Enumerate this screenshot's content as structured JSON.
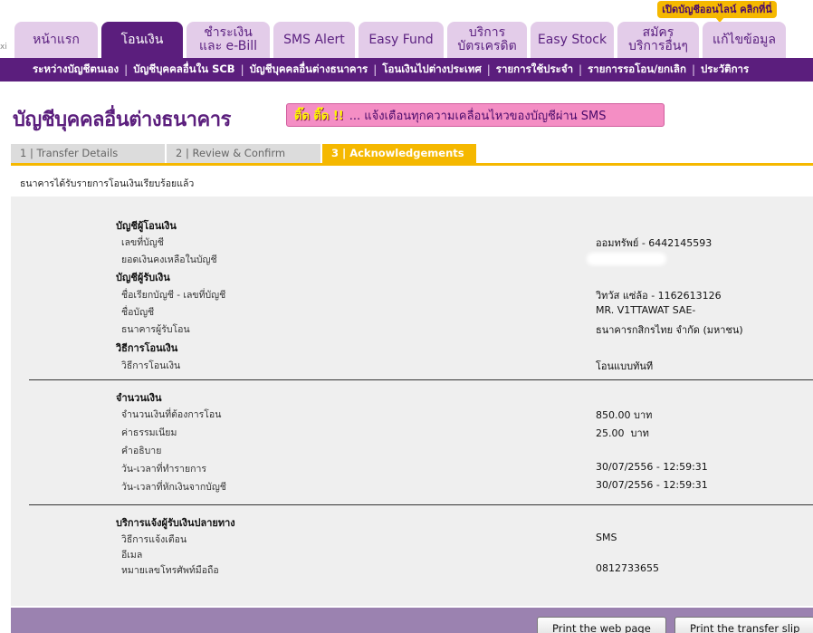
{
  "promo": {
    "label": "เปิดบัญชีออนไลน์ คลิกที่นี่"
  },
  "corner_mark": "xi",
  "tabs": [
    {
      "label": "หน้าแรก"
    },
    {
      "label": "โอนเงิน"
    },
    {
      "label": "ชำระเงิน\nและ e-Bill"
    },
    {
      "label": "SMS Alert"
    },
    {
      "label": "Easy Fund"
    },
    {
      "label": "บริการ\nบัตรเครดิต"
    },
    {
      "label": "Easy Stock"
    },
    {
      "label": "สมัคร\nบริการอื่นๆ"
    },
    {
      "label": "แก้ไขข้อมูล"
    }
  ],
  "subnav": [
    "ระหว่างบัญชีตนเอง",
    "บัญชีบุคคลอื่นใน SCB",
    "บัญชีบุคคลอื่นต่างธนาคาร",
    "โอนเงินไปต่างประเทศ",
    "รายการใช้ประจำ",
    "รายการรอโอน/ยกเลิก",
    "ประวัติการ"
  ],
  "page_title": "บัญชีบุคคลอื่นต่างธนาคาร",
  "banner": {
    "highlight": "ติ๊ด ติ๊ด !!",
    "text": "... แจ้งเตือนทุกความเคลื่อนไหวของบัญชีผ่าน SMS"
  },
  "steps": [
    {
      "label": "1 | Transfer Details"
    },
    {
      "label": "2 | Review & Confirm"
    },
    {
      "label": "3 | Acknowledgements"
    }
  ],
  "confirm_message": "ธนาคารได้รับรายการโอนเงินเรียบร้อยแล้ว",
  "from_account": {
    "heading": "บัญชีผู้โอนเงิน",
    "account_number_label": "เลขที่บัญชี",
    "account_number_value": "ออมทรัพย์ - 6442145593",
    "balance_label": "ยอดเงินคงเหลือในบัญชี"
  },
  "to_account": {
    "heading": "บัญชีผู้รับเงิน",
    "nickname_label": "ชื่อเรียกบัญชี - เลขที่บัญชี",
    "nickname_value": "วิทวัส แซ่ล้อ - 1162613126",
    "name_label": "ชื่อบัญชี",
    "name_value": "MR. V1TTAWAT SAE-",
    "bank_label": "ธนาคารผู้รับโอน",
    "bank_value": "ธนาคารกสิกรไทย จำกัด (มหาชน)"
  },
  "method": {
    "heading": "วิธีการโอนเงิน",
    "label": "วิธีการโอนเงิน",
    "value": "โอนแบบทันที"
  },
  "amount": {
    "heading": "จำนวนเงิน",
    "amount_label": "จำนวนเงินที่ต้องการโอน",
    "amount_value": "850.00 บาท",
    "fee_label": "ค่าธรรมเนียม",
    "fee_value": "25.00  บาท",
    "note_label": "คำอธิบาย",
    "txn_time_label": "วัน-เวลาที่ทำรายการ",
    "txn_time_value": "30/07/2556 - 12:59:31",
    "debit_time_label": "วัน-เวลาที่หักเงินจากบัญชี",
    "debit_time_value": "30/07/2556 - 12:59:31"
  },
  "notify": {
    "heading": "บริการแจ้งผู้รับเงินปลายทาง",
    "method_label": "วิธีการแจ้งเตือน",
    "method_value": "SMS",
    "email_label": "อีเมล",
    "phone_label": "หมายเลขโทรศัพท์มือถือ",
    "phone_value": "0812733655"
  },
  "buttons": {
    "print_page": "Print the web page",
    "print_slip": "Print the transfer slip"
  }
}
